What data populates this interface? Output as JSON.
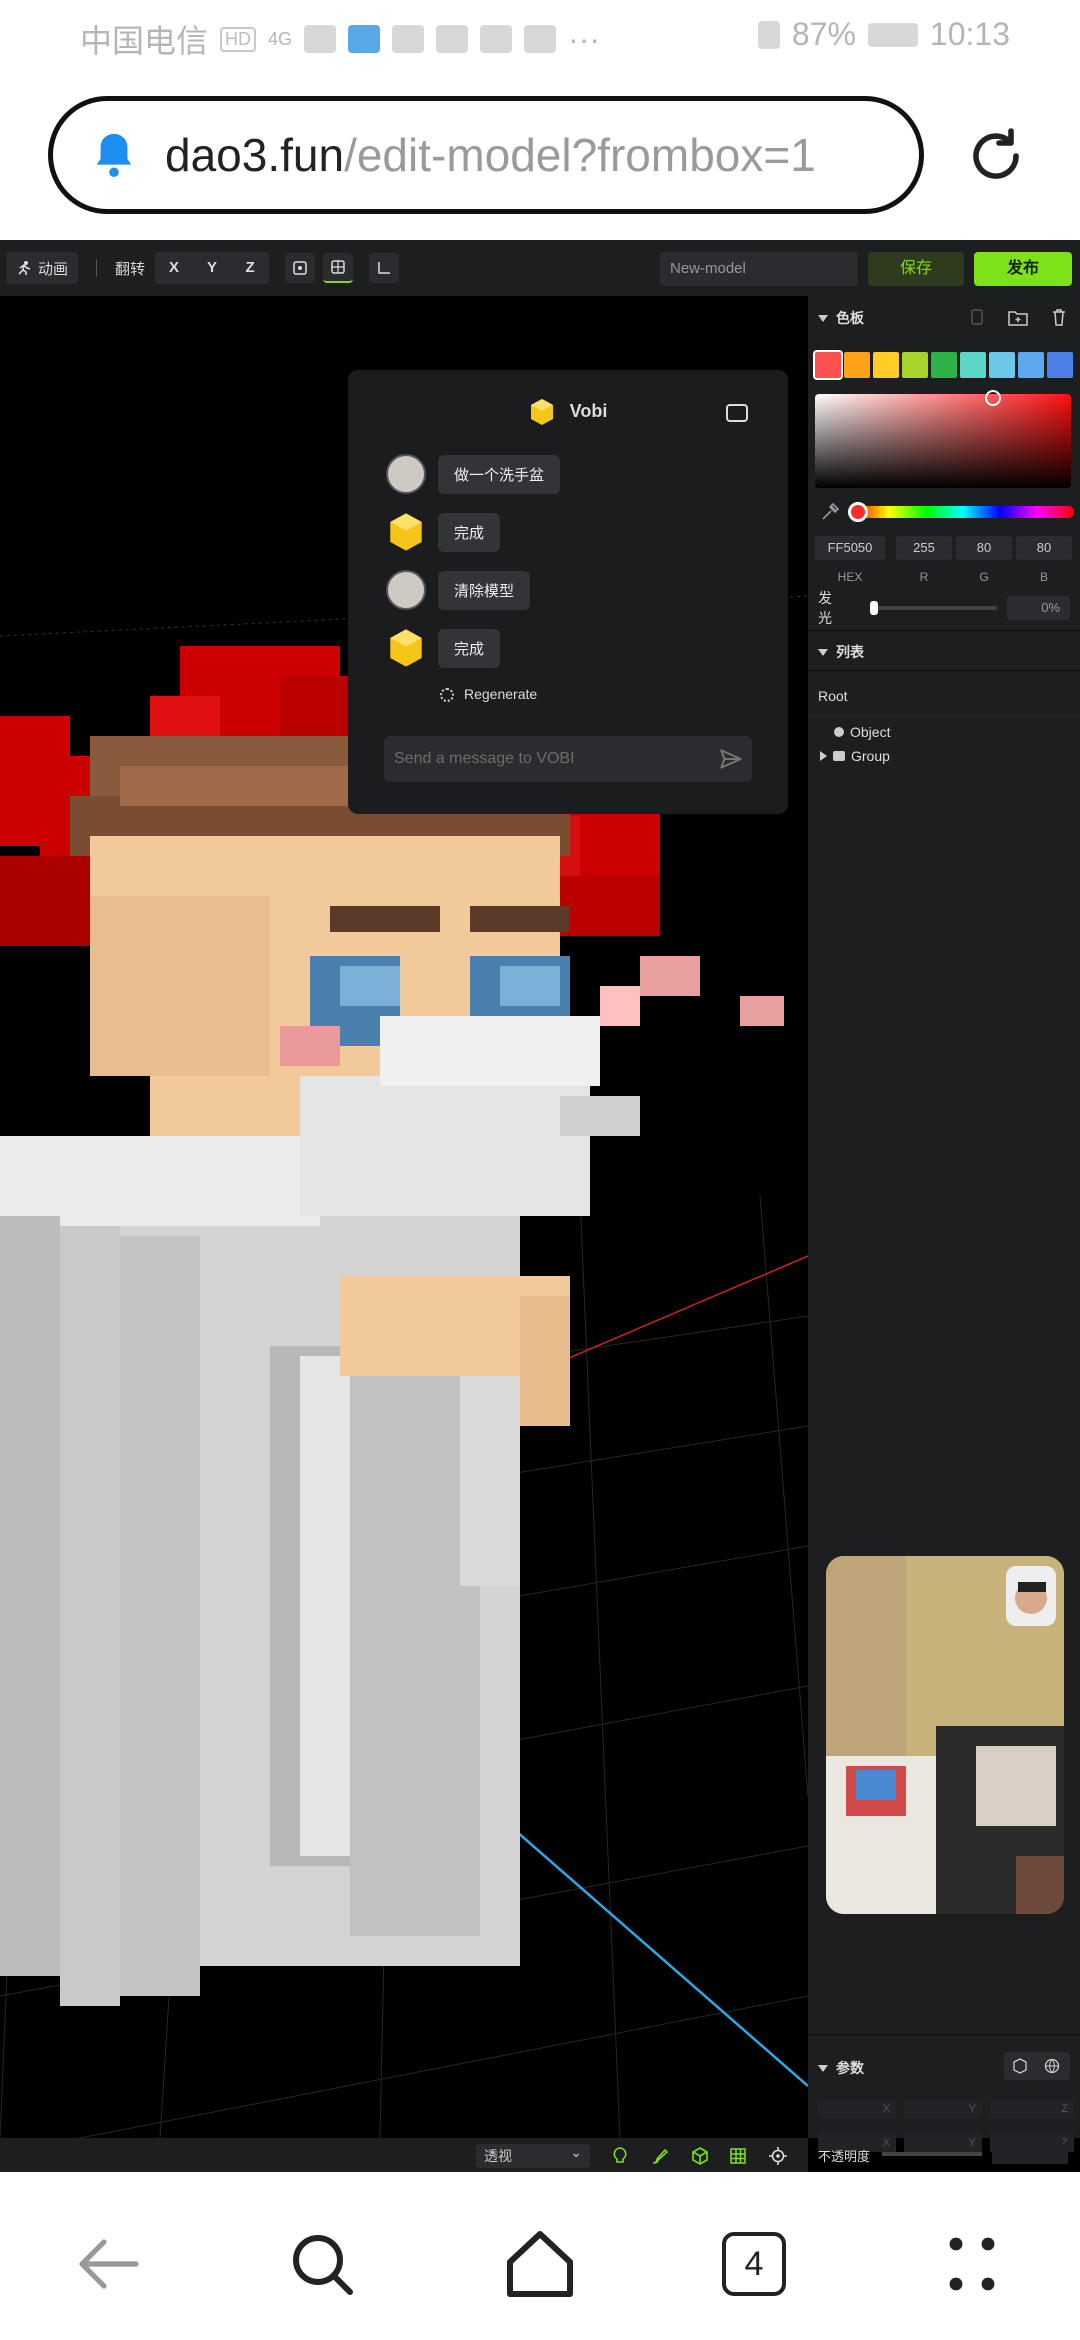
{
  "status_bar": {
    "carrier": "中国电信",
    "hd_badge": "HD",
    "signal": "4G",
    "battery": "87%",
    "time": "10:13"
  },
  "browser": {
    "url_host": "dao3.fun",
    "url_path": "/edit-model?frombox=1",
    "tab_count": "4"
  },
  "toolbar": {
    "animation_label": "动画",
    "flip_label": "翻转",
    "axes": [
      "X",
      "Y",
      "Z"
    ],
    "model_name": "New-model",
    "save_label": "保存",
    "publish_label": "发布"
  },
  "chat": {
    "title": "Vobi",
    "messages": [
      {
        "from": "user",
        "text": "做一个洗手盆"
      },
      {
        "from": "bot",
        "text": "完成"
      },
      {
        "from": "user",
        "text": "清除模型"
      },
      {
        "from": "bot",
        "text": "完成"
      }
    ],
    "regenerate_label": "Regenerate",
    "input_placeholder": "Send a message to VOBI"
  },
  "palette": {
    "title": "色板",
    "swatches": [
      "#ff5050",
      "#ffa21a",
      "#ffcd26",
      "#a7d42b",
      "#2eb24a",
      "#5cd6c6",
      "#6cc7e8",
      "#5ca7ee",
      "#4d7fe8"
    ],
    "hex_value": "FF5050",
    "r": "255",
    "g": "80",
    "b": "80",
    "hex_label": "HEX",
    "r_label": "R",
    "g_label": "G",
    "b_label": "B",
    "glow_label": "发光",
    "glow_value": "0%"
  },
  "list": {
    "title": "列表",
    "root": "Root",
    "items": [
      "Object",
      "Group"
    ]
  },
  "params": {
    "title": "参数",
    "axis_labels": [
      "X",
      "Y",
      "Z"
    ],
    "opacity_label": "不透明度"
  },
  "bottom_bar": {
    "view_mode": "透视"
  }
}
